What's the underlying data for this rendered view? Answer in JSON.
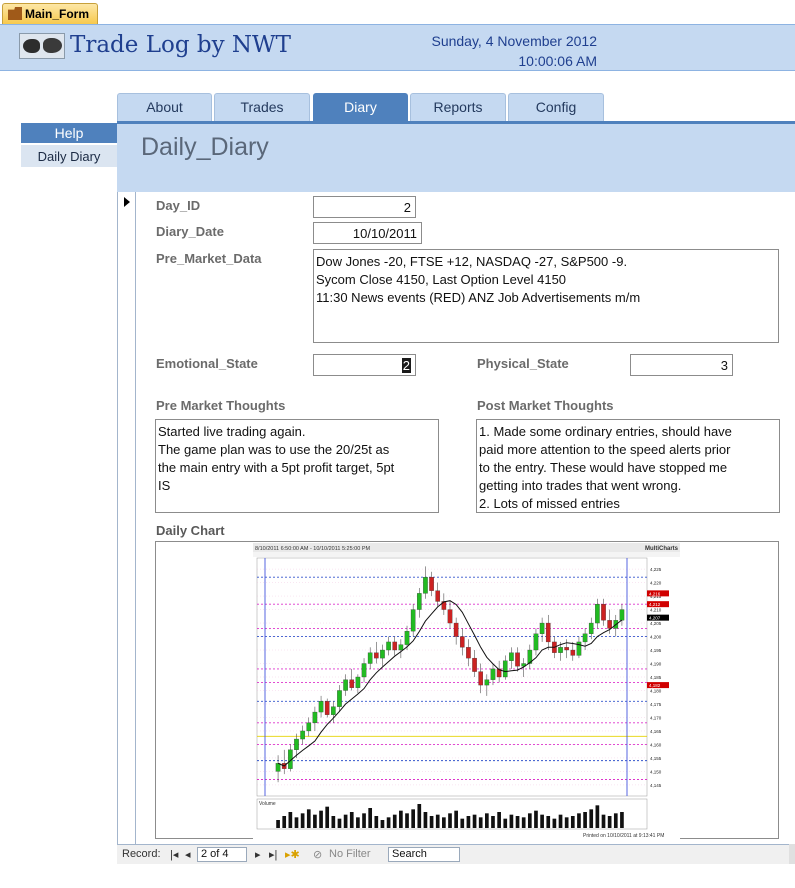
{
  "window": {
    "form_tab_label": "Main_Form"
  },
  "header": {
    "app_title": "Trade Log by NWT",
    "date": "Sunday, 4 November 2012",
    "time": "10:00:06 AM"
  },
  "nav_tabs": [
    {
      "label": "About"
    },
    {
      "label": "Trades"
    },
    {
      "label": "Diary",
      "active": true
    },
    {
      "label": "Reports"
    },
    {
      "label": "Config"
    }
  ],
  "left_nav": {
    "help": "Help",
    "daily_diary": "Daily Diary"
  },
  "subform": {
    "title": "Daily_Diary"
  },
  "fields": {
    "day_id": {
      "label": "Day_ID",
      "value": "2"
    },
    "diary_date": {
      "label": "Diary_Date",
      "value": "10/10/2011"
    },
    "pre_market_data": {
      "label": "Pre_Market_Data",
      "lines": [
        "Dow Jones -20, FTSE +12, NASDAQ -27, S&P500 -9.",
        "Sycom Close 4150, Last Option Level 4150",
        "11:30 News events (RED) ANZ Job Advertisements m/m"
      ]
    },
    "emotional_state": {
      "label": "Emotional_State",
      "value": "2"
    },
    "physical_state": {
      "label": "Physical_State",
      "value": "3"
    },
    "pre_market_thoughts": {
      "label": "Pre Market Thoughts",
      "lines": [
        "Started live trading again.",
        "The game plan was to use the 20/25t as",
        "the main entry with a 5pt profit target, 5pt",
        "IS"
      ]
    },
    "post_market_thoughts": {
      "label": "Post Market Thoughts",
      "lines": [
        "1. Made some ordinary entries, should have",
        "paid more attention to the speed alerts prior",
        "to the entry. These would have stopped me",
        "getting into trades that went wrong.",
        "2. Lots of missed entries"
      ]
    },
    "daily_chart": {
      "label": "Daily Chart"
    }
  },
  "chart": {
    "header_text": "8/10/2011 6:50:00 AM - 10/10/2011 5:25:00 PM",
    "brand": "MultiCharts",
    "footer_text": "Printed on 10/10/2011 at 9:13:41 PM",
    "volume_label": "Volume",
    "price_ticks": [
      "4,225",
      "4,220",
      "4,215",
      "4,210",
      "4,205",
      "4,200",
      "4,195",
      "4,190",
      "4,185",
      "4,180",
      "4,175",
      "4,170",
      "4,165",
      "4,160",
      "4,155",
      "4,150",
      "4,145"
    ],
    "price_min": 4142,
    "price_max": 4228,
    "price_tags": [
      {
        "value": "4,216",
        "price": 4216,
        "color": "#d00000"
      },
      {
        "value": "4,212",
        "price": 4212,
        "color": "#d00000"
      },
      {
        "value": "4,207",
        "price": 4207,
        "color": "#000000"
      },
      {
        "value": "4,182",
        "price": 4182,
        "color": "#d00000"
      }
    ],
    "candles": [
      [
        4150,
        4156,
        4146,
        4153
      ],
      [
        4153,
        4158,
        4149,
        4151
      ],
      [
        4151,
        4160,
        4150,
        4158
      ],
      [
        4158,
        4164,
        4155,
        4162
      ],
      [
        4162,
        4167,
        4160,
        4165
      ],
      [
        4165,
        4170,
        4163,
        4168
      ],
      [
        4168,
        4174,
        4165,
        4172
      ],
      [
        4172,
        4178,
        4170,
        4176
      ],
      [
        4176,
        4177,
        4170,
        4171
      ],
      [
        4171,
        4176,
        4168,
        4174
      ],
      [
        4174,
        4182,
        4172,
        4180
      ],
      [
        4180,
        4186,
        4178,
        4184
      ],
      [
        4184,
        4188,
        4180,
        4181
      ],
      [
        4181,
        4186,
        4179,
        4185
      ],
      [
        4185,
        4192,
        4183,
        4190
      ],
      [
        4190,
        4196,
        4188,
        4194
      ],
      [
        4194,
        4198,
        4190,
        4192
      ],
      [
        4192,
        4197,
        4189,
        4195
      ],
      [
        4195,
        4200,
        4193,
        4198
      ],
      [
        4198,
        4200,
        4193,
        4195
      ],
      [
        4195,
        4199,
        4192,
        4197
      ],
      [
        4197,
        4204,
        4195,
        4202
      ],
      [
        4202,
        4212,
        4200,
        4210
      ],
      [
        4210,
        4218,
        4207,
        4216
      ],
      [
        4216,
        4226,
        4214,
        4222
      ],
      [
        4222,
        4224,
        4215,
        4217
      ],
      [
        4217,
        4220,
        4211,
        4213
      ],
      [
        4213,
        4216,
        4208,
        4210
      ],
      [
        4210,
        4213,
        4203,
        4205
      ],
      [
        4205,
        4207,
        4197,
        4200
      ],
      [
        4200,
        4203,
        4193,
        4196
      ],
      [
        4196,
        4199,
        4189,
        4192
      ],
      [
        4192,
        4195,
        4185,
        4187
      ],
      [
        4187,
        4190,
        4179,
        4182
      ],
      [
        4182,
        4186,
        4178,
        4184
      ],
      [
        4184,
        4190,
        4182,
        4188
      ],
      [
        4188,
        4191,
        4183,
        4185
      ],
      [
        4185,
        4193,
        4184,
        4191
      ],
      [
        4191,
        4196,
        4188,
        4194
      ],
      [
        4194,
        4196,
        4187,
        4189
      ],
      [
        4189,
        4192,
        4185,
        4190
      ],
      [
        4190,
        4197,
        4188,
        4195
      ],
      [
        4195,
        4203,
        4193,
        4201
      ],
      [
        4201,
        4207,
        4198,
        4205
      ],
      [
        4205,
        4208,
        4195,
        4198
      ],
      [
        4198,
        4200,
        4192,
        4194
      ],
      [
        4194,
        4198,
        4191,
        4196
      ],
      [
        4196,
        4199,
        4192,
        4195
      ],
      [
        4195,
        4198,
        4191,
        4193
      ],
      [
        4193,
        4200,
        4192,
        4198
      ],
      [
        4198,
        4203,
        4195,
        4201
      ],
      [
        4201,
        4207,
        4199,
        4205
      ],
      [
        4205,
        4214,
        4203,
        4212
      ],
      [
        4212,
        4214,
        4204,
        4206
      ],
      [
        4206,
        4210,
        4201,
        4203
      ],
      [
        4203,
        4208,
        4200,
        4206
      ],
      [
        4206,
        4212,
        4204,
        4210
      ]
    ],
    "volume": [
      30,
      45,
      60,
      40,
      55,
      70,
      50,
      65,
      80,
      45,
      35,
      50,
      60,
      40,
      55,
      75,
      45,
      30,
      40,
      50,
      65,
      55,
      70,
      90,
      60,
      45,
      50,
      40,
      55,
      65,
      35,
      45,
      50,
      40,
      55,
      45,
      60,
      35,
      50,
      45,
      40,
      55,
      65,
      50,
      45,
      35,
      50,
      40,
      45,
      55,
      60,
      70,
      85,
      50,
      45,
      55,
      60
    ]
  },
  "record_nav": {
    "record_label": "Record:",
    "position": "2 of 4",
    "no_filter": "No Filter",
    "search": "Search"
  }
}
